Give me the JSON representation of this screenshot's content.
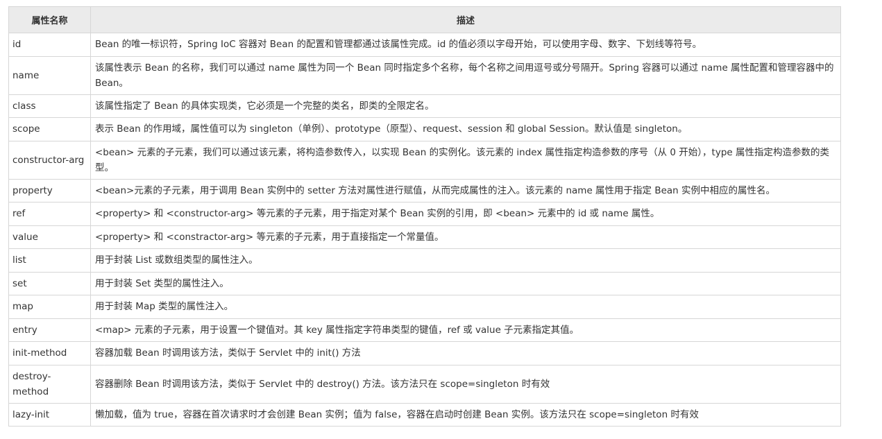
{
  "table": {
    "headers": {
      "name": "属性名称",
      "desc": "描述"
    },
    "rows": [
      {
        "name": "id",
        "desc": "Bean 的唯一标识符，Spring IoC 容器对 Bean 的配置和管理都通过该属性完成。id 的值必须以字母开始，可以使用字母、数字、下划线等符号。"
      },
      {
        "name": "name",
        "desc": "该属性表示 Bean 的名称，我们可以通过 name 属性为同一个 Bean 同时指定多个名称，每个名称之间用逗号或分号隔开。Spring 容器可以通过 name 属性配置和管理容器中的 Bean。"
      },
      {
        "name": "class",
        "desc": "该属性指定了 Bean 的具体实现类，它必须是一个完整的类名，即类的全限定名。"
      },
      {
        "name": "scope",
        "desc": "表示 Bean 的作用域，属性值可以为 singleton（单例）、prototype（原型）、request、session 和 global Session。默认值是 singleton。"
      },
      {
        "name": "constructor-arg",
        "desc": "<bean> 元素的子元素，我们可以通过该元素，将构造参数传入，以实现 Bean 的实例化。该元素的 index 属性指定构造参数的序号（从 0 开始），type 属性指定构造参数的类型。"
      },
      {
        "name": "property",
        "desc": "<bean>元素的子元素，用于调用 Bean 实例中的 setter 方法对属性进行赋值，从而完成属性的注入。该元素的 name 属性用于指定 Bean 实例中相应的属性名。"
      },
      {
        "name": "ref",
        "desc": "<property> 和 <constructor-arg> 等元素的子元素，用于指定对某个 Bean 实例的引用，即 <bean> 元素中的 id 或 name 属性。"
      },
      {
        "name": "value",
        "desc": "<property> 和 <constractor-arg> 等元素的子元素，用于直接指定一个常量值。"
      },
      {
        "name": "list",
        "desc": "用于封装 List 或数组类型的属性注入。"
      },
      {
        "name": "set",
        "desc": "用于封装 Set 类型的属性注入。"
      },
      {
        "name": "map",
        "desc": "用于封装 Map 类型的属性注入。"
      },
      {
        "name": "entry",
        "desc": " <map> 元素的子元素，用于设置一个键值对。其 key 属性指定字符串类型的键值，ref 或 value 子元素指定其值。"
      },
      {
        "name": "init-method",
        "desc": "容器加载 Bean 时调用该方法，类似于 Servlet 中的 init() 方法"
      },
      {
        "name": "destroy-method",
        "desc": "容器删除 Bean 时调用该方法，类似于 Servlet 中的 destroy() 方法。该方法只在 scope=singleton 时有效"
      },
      {
        "name": "lazy-init",
        "desc": "懒加载，值为 true，容器在首次请求时才会创建 Bean 实例；值为 false，容器在启动时创建 Bean 实例。该方法只在 scope=singleton 时有效"
      }
    ]
  }
}
